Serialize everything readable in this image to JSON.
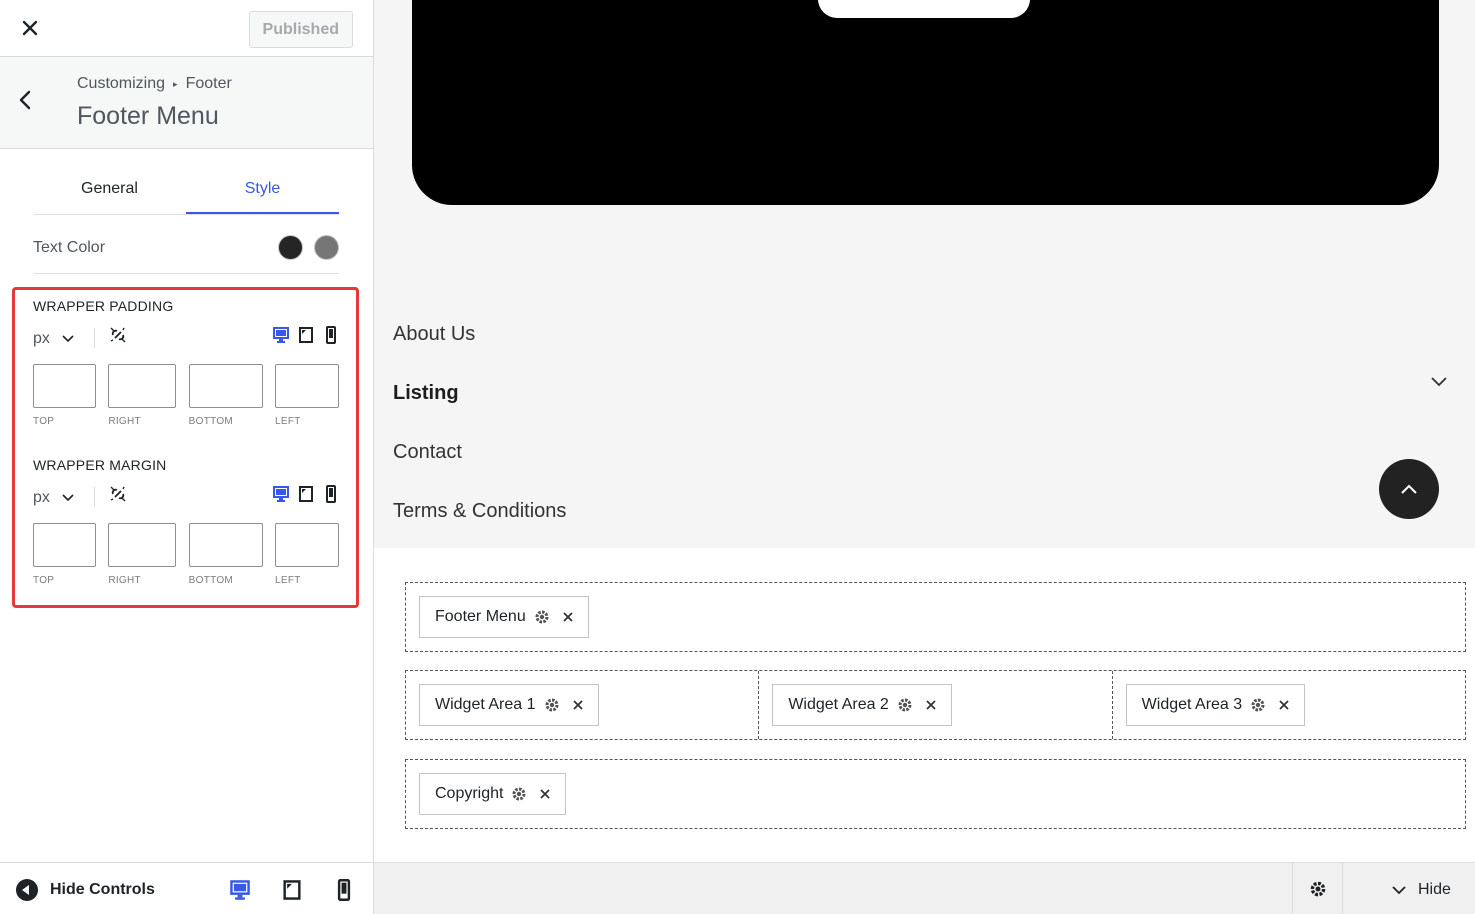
{
  "header": {
    "publish_label": "Published"
  },
  "section": {
    "breadcrumb_root": "Customizing",
    "breadcrumb_parent": "Footer",
    "title": "Footer Menu"
  },
  "tabs": [
    {
      "label": "General",
      "active": false
    },
    {
      "label": "Style",
      "active": true
    }
  ],
  "text_color": {
    "label": "Text Color",
    "swatches": [
      "#252525",
      "#767676"
    ]
  },
  "wrapper_padding": {
    "title": "WRAPPER PADDING",
    "unit": "px",
    "fields": [
      "TOP",
      "RIGHT",
      "BOTTOM",
      "LEFT"
    ],
    "values": [
      "",
      "",
      "",
      ""
    ]
  },
  "wrapper_margin": {
    "title": "WRAPPER MARGIN",
    "unit": "px",
    "fields": [
      "TOP",
      "RIGHT",
      "BOTTOM",
      "LEFT"
    ],
    "values": [
      "",
      "",
      "",
      ""
    ]
  },
  "footer_controls": {
    "hide_label": "Hide Controls"
  },
  "preview": {
    "menu": [
      "About Us",
      "Listing",
      "Contact",
      "Terms & Conditions"
    ],
    "builder_rows": [
      [
        "Footer Menu"
      ],
      [
        "Widget Area 1",
        "Widget Area 2",
        "Widget Area 3"
      ],
      [
        "Copyright"
      ]
    ],
    "hide_label": "Hide"
  },
  "colors": {
    "accent": "#3858e9",
    "highlight": "#e5383b"
  }
}
